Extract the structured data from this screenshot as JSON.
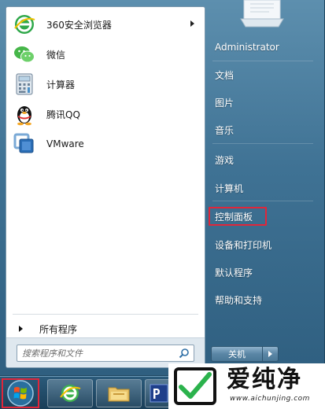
{
  "start_menu": {
    "pinned": [
      {
        "label": "360安全浏览器",
        "icon": "ie-360-browser-icon",
        "has_submenu": true
      },
      {
        "label": "微信",
        "icon": "wechat-icon",
        "has_submenu": false
      },
      {
        "label": "计算器",
        "icon": "calculator-icon",
        "has_submenu": false
      },
      {
        "label": "腾讯QQ",
        "icon": "qq-penguin-icon",
        "has_submenu": false
      },
      {
        "label": "VMware",
        "icon": "vmware-icon",
        "has_submenu": false
      }
    ],
    "all_programs": "所有程序",
    "search": {
      "placeholder": "搜索程序和文件"
    },
    "right": [
      {
        "label": "Administrator"
      },
      {
        "label": "文档"
      },
      {
        "label": "图片"
      },
      {
        "label": "音乐"
      },
      {
        "label": "游戏"
      },
      {
        "label": "计算机"
      },
      {
        "label": "控制面板",
        "highlighted": true
      },
      {
        "label": "设备和打印机"
      },
      {
        "label": "默认程序"
      },
      {
        "label": "帮助和支持"
      }
    ],
    "shutdown": {
      "label": "关机"
    }
  },
  "taskbar": {
    "start_button": "windows-start-orb",
    "buttons": [
      "ie-browser-icon",
      "file-explorer-icon",
      "app-icon-partial"
    ]
  },
  "watermark": {
    "title": "爱纯净",
    "url": "www.aichunjing.com"
  },
  "colors": {
    "highlight_border": "#e0263a",
    "menu_blue": "#3f7294"
  }
}
